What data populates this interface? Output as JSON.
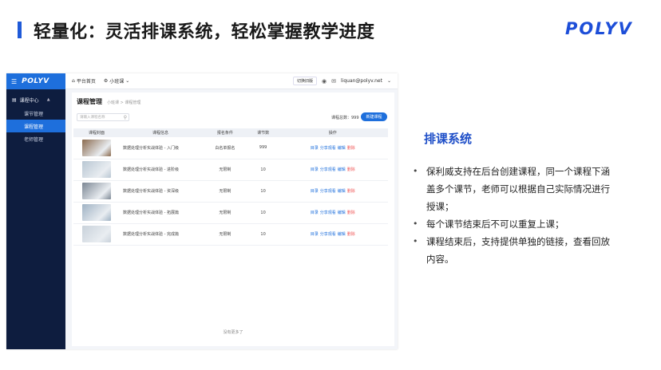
{
  "slide": {
    "title": "轻量化：灵活排课系统，轻松掌握教学进度",
    "logo": "POLYV",
    "accent_color": "#1f5ad8"
  },
  "app": {
    "sidebar": {
      "logo": "POLYV",
      "menu_icon": "hamburger-icon",
      "group_label": "课程中心",
      "items": [
        {
          "label": "课节管理",
          "active": false
        },
        {
          "label": "课程管理",
          "active": true
        },
        {
          "label": "老师管理",
          "active": false
        }
      ]
    },
    "topbar": {
      "home_label": "平台首页",
      "class_label": "小班课",
      "switch_label": "切换旧版",
      "email": "liquan@polyv.net"
    },
    "page": {
      "title": "课程管理",
      "breadcrumb": "小班课 > 课程管理",
      "search_placeholder": "请输入课程名称",
      "total_label": "课程总数：999",
      "new_button": "新建课程"
    },
    "table": {
      "headers": [
        "课程封面",
        "课程信息",
        "报名条件",
        "课节数",
        "操作"
      ],
      "rows": [
        {
          "info": "数据处理分析实战体验 - 入门级",
          "condition": "白名单报名",
          "lessons": "999",
          "thumb_color": "#8a6a4e"
        },
        {
          "info": "数据处理分析实战体验 - 进阶级",
          "condition": "无限制",
          "lessons": "10",
          "thumb_color": "#b9c7d3"
        },
        {
          "info": "数据处理分析实战体验 - 资深级",
          "condition": "无限制",
          "lessons": "10",
          "thumb_color": "#7c8794"
        },
        {
          "info": "数据处理分析实战体验 - 拓展篇",
          "condition": "无限制",
          "lessons": "10",
          "thumb_color": "#9fb2c4"
        },
        {
          "info": "数据处理分析实战体验 - 完成篇",
          "condition": "无限制",
          "lessons": "10",
          "thumb_color": "#c8d1da"
        }
      ],
      "ops": [
        "目录",
        "分享观看",
        "编辑",
        "删除"
      ],
      "no_more": "没有更多了"
    }
  },
  "section": {
    "title": "排课系统",
    "bullets": [
      "保利威支持在后台创建课程，同一个课程下涵盖多个课节，老师可以根据自己实际情况进行授课；",
      "每个课节结束后不可以重复上课；",
      "课程结束后，支持提供单独的链接，查看回放内容。"
    ]
  }
}
